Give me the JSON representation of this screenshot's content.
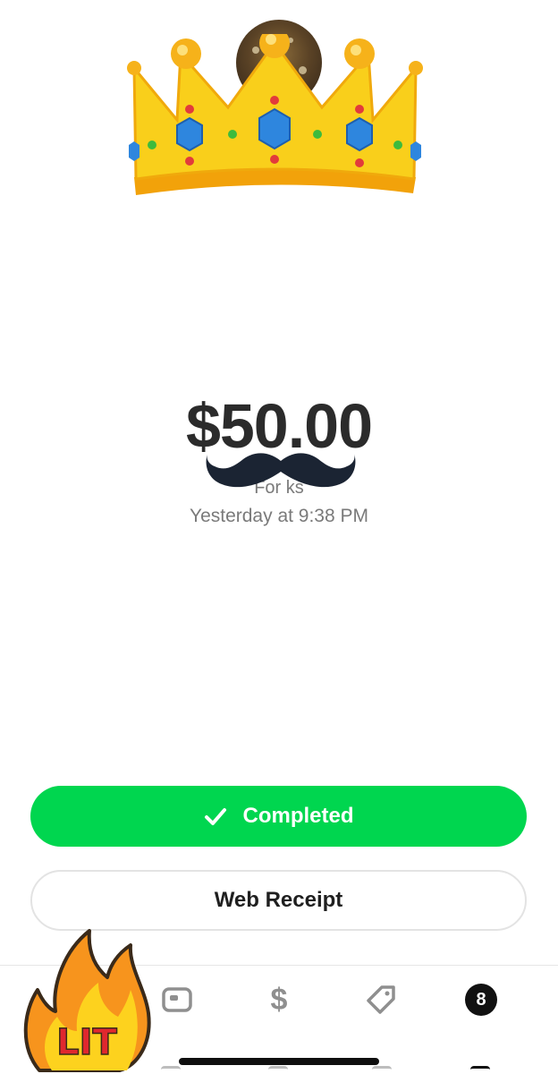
{
  "payment": {
    "amount": "$50.00",
    "for_line": "For ks",
    "timestamp": "Yesterday at 9:38 PM"
  },
  "actions": {
    "completed_label": "Completed",
    "receipt_label": "Web Receipt"
  },
  "tabbar": {
    "dollar_glyph": "$",
    "activity_badge": "8"
  },
  "stickers": {
    "lit_text": "LIT"
  },
  "colors": {
    "accent": "#00d64f",
    "text_primary": "#2b2b2b",
    "text_secondary": "#7a7a7a"
  },
  "icons": [
    "crown-sticker",
    "mustache-sticker",
    "check-icon",
    "card-icon",
    "dollar-icon",
    "tag-icon",
    "activity-badge",
    "fire-lit-sticker"
  ]
}
